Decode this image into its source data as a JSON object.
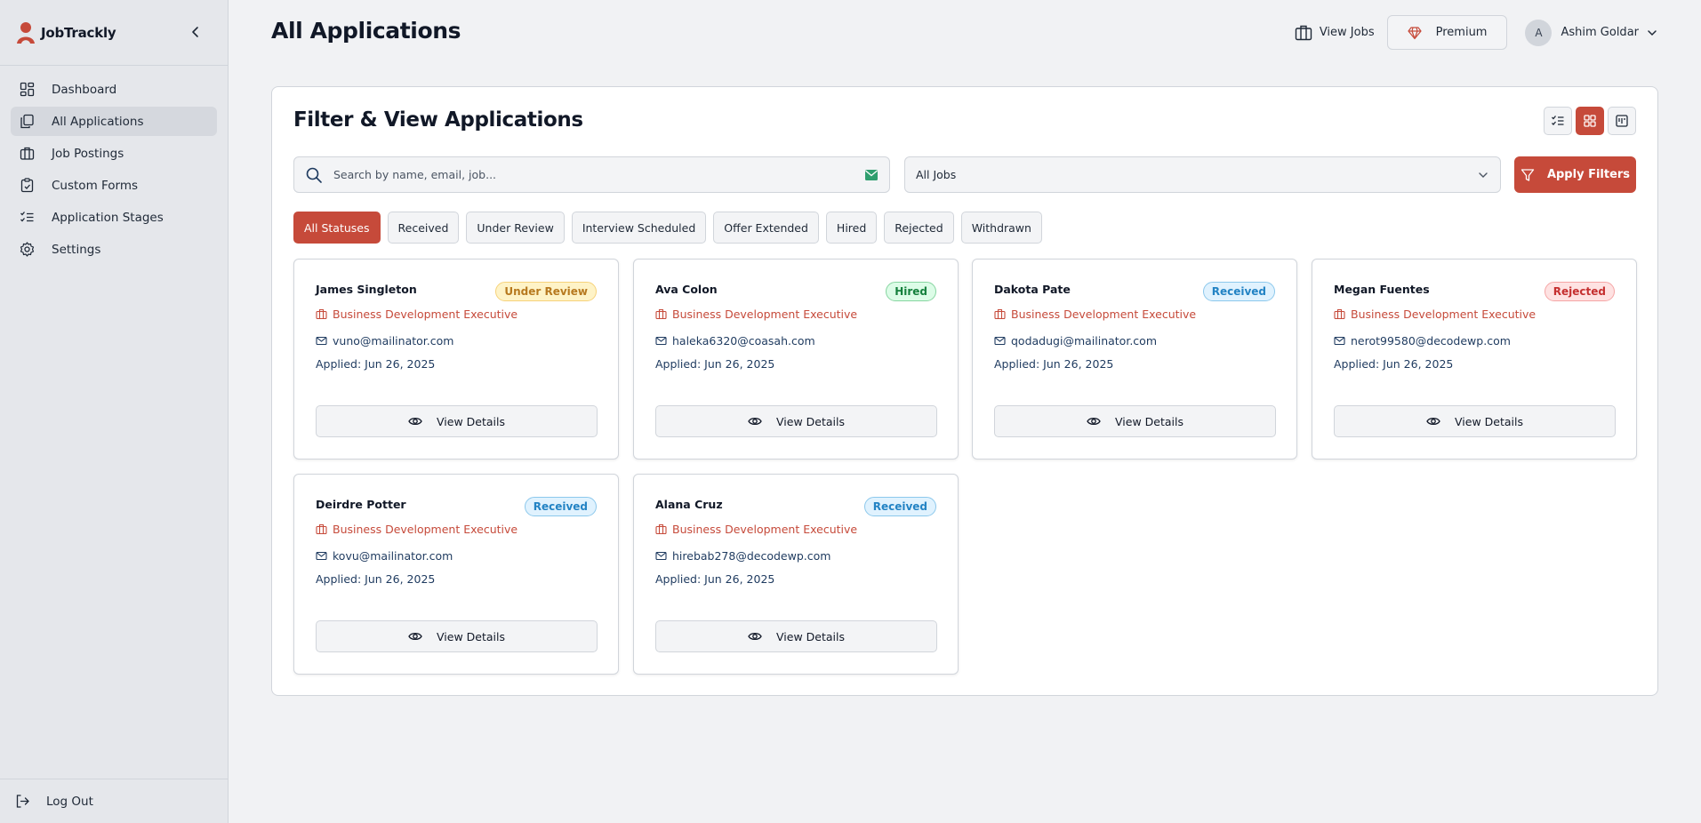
{
  "brand": {
    "name": "JobTrackly"
  },
  "sidebar": {
    "items": [
      {
        "label": "Dashboard",
        "icon": "dashboard-icon"
      },
      {
        "label": "All Applications",
        "icon": "copy-icon",
        "active": true
      },
      {
        "label": "Job Postings",
        "icon": "briefcase-icon"
      },
      {
        "label": "Custom Forms",
        "icon": "clipboard-icon"
      },
      {
        "label": "Application Stages",
        "icon": "list-checks-icon"
      },
      {
        "label": "Settings",
        "icon": "gear-icon"
      }
    ],
    "logout": "Log Out"
  },
  "header": {
    "title": "All Applications",
    "view_jobs": "View Jobs",
    "premium": "Premium",
    "user_initial": "A",
    "user_name": "Ashim Goldar"
  },
  "filter": {
    "title": "Filter & View Applications",
    "search_placeholder": "Search by name, email, job...",
    "jobs_selected": "All Jobs",
    "apply_label": "Apply Filters",
    "statuses": [
      "All Statuses",
      "Received",
      "Under Review",
      "Interview Scheduled",
      "Offer Extended",
      "Hired",
      "Rejected",
      "Withdrawn"
    ],
    "active_status": "All Statuses"
  },
  "colors": {
    "accent": "#c64a3a",
    "under_review": "#b7791f",
    "hired": "#15803d",
    "received": "#2383c4",
    "rejected": "#c53030"
  },
  "applications": [
    {
      "name": "James Singleton",
      "status": "Under Review",
      "status_class": "review",
      "role": "Business Development Executive",
      "email": "vuno@mailinator.com",
      "applied": "Applied: Jun 26, 2025",
      "action": "View Details"
    },
    {
      "name": "Ava Colon",
      "status": "Hired",
      "status_class": "hired",
      "role": "Business Development Executive",
      "email": "haleka6320@coasah.com",
      "applied": "Applied: Jun 26, 2025",
      "action": "View Details"
    },
    {
      "name": "Dakota Pate",
      "status": "Received",
      "status_class": "received",
      "role": "Business Development Executive",
      "email": "qodadugi@mailinator.com",
      "applied": "Applied: Jun 26, 2025",
      "action": "View Details"
    },
    {
      "name": "Megan Fuentes",
      "status": "Rejected",
      "status_class": "rejected",
      "role": "Business Development Executive",
      "email": "nerot99580@decodewp.com",
      "applied": "Applied: Jun 26, 2025",
      "action": "View Details"
    },
    {
      "name": "Deirdre Potter",
      "status": "Received",
      "status_class": "received",
      "role": "Business Development Executive",
      "email": "kovu@mailinator.com",
      "applied": "Applied: Jun 26, 2025",
      "action": "View Details"
    },
    {
      "name": "Alana Cruz",
      "status": "Received",
      "status_class": "received",
      "role": "Business Development Executive",
      "email": "hirebab278@decodewp.com",
      "applied": "Applied: Jun 26, 2025",
      "action": "View Details"
    }
  ]
}
